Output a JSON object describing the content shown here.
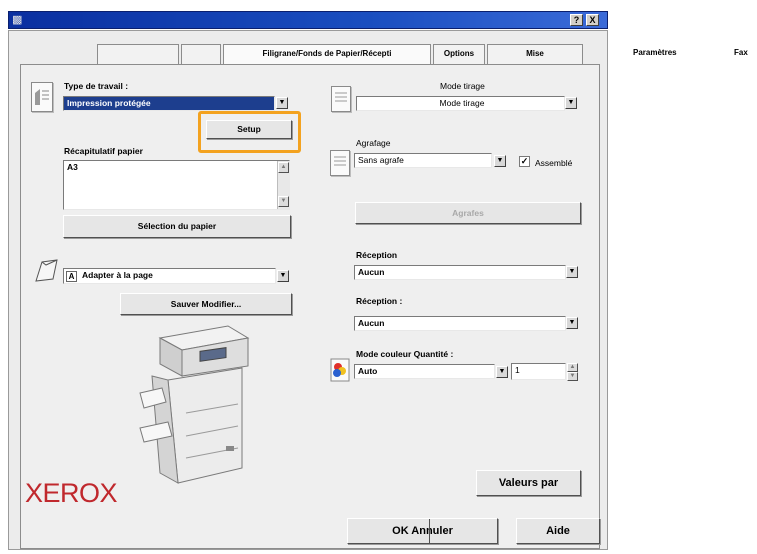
{
  "window": {
    "help_glyph": "?",
    "close_glyph": "X"
  },
  "tabs": {
    "items": [
      "",
      "",
      "Filigrane/Fonds de Papier/Récepti",
      "Options",
      "Mise"
    ],
    "overflow": [
      "Paramètres",
      "Fax"
    ]
  },
  "left": {
    "job_type_label": "Type de travail :",
    "job_type_value": "Impression protégée",
    "setup_button": "Setup",
    "paper_summary_label": "Récapitulatif papier",
    "paper_summary_value": "A3",
    "paper_select_button": "Sélection du papier",
    "fit_value": "Adapter à la page",
    "save_button": "Sauver Modifier...",
    "logo": "XEROX"
  },
  "right": {
    "print_mode_label": "Mode tirage",
    "print_mode_value": "Mode tirage",
    "staple_label": "Agrafage",
    "staple_value": "Sans agrafe",
    "collate_label": "Assemblé",
    "collate_checked": true,
    "staples_button": "Agrafes",
    "reception1_label": "Réception",
    "reception1_value": "Aucun",
    "reception2_label": "Réception :",
    "reception2_value": "Aucun",
    "color_label": "Mode couleur Quantité :",
    "color_value": "Auto",
    "quantity_value": "1",
    "defaults_button": "Valeurs par"
  },
  "footer": {
    "ok_cancel_button": "OK Annuler",
    "help_button": "Aide"
  },
  "colors": {
    "titlebar": "#1a4ec0",
    "highlight": "#f3a21f",
    "selection": "#1d3e8e",
    "logo": "#c0282d"
  }
}
